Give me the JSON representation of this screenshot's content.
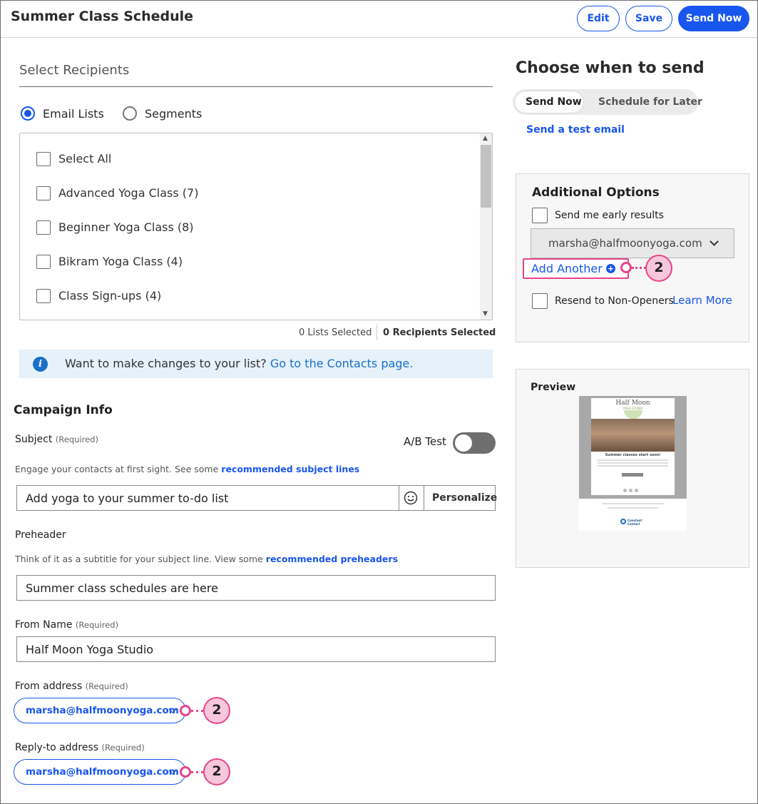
{
  "header": {
    "title": "Summer Class Schedule",
    "edit_label": "Edit",
    "save_label": "Save",
    "send_now_label": "Send Now"
  },
  "recipients": {
    "section_title": "Select Recipients",
    "radio_email_lists": "Email Lists",
    "radio_segments": "Segments",
    "selected_radio": "Email Lists",
    "items": [
      {
        "label": "Select All",
        "checked": false
      },
      {
        "label": "Advanced Yoga Class (7)",
        "checked": false
      },
      {
        "label": "Beginner Yoga Class (8)",
        "checked": false
      },
      {
        "label": "Bikram Yoga Class (4)",
        "checked": false
      },
      {
        "label": "Class Sign-ups (4)",
        "checked": false
      }
    ],
    "lists_selected": "0 Lists Selected",
    "recipients_selected": "0 Recipients Selected",
    "info_text": "Want to make changes to your list?",
    "info_link": "Go to the Contacts page."
  },
  "campaign": {
    "title": "Campaign Info",
    "subject_label": "Subject",
    "required": "(Required)",
    "ab_test_label": "A/B Test",
    "ab_test_on": false,
    "subject_help": "Engage your contacts at first sight. See some",
    "subject_help_link": "recommended subject lines",
    "subject_value": "Add yoga to your summer to-do list",
    "emoji_icon": "smiley-icon",
    "personalize_label": "Personalize",
    "preheader_label": "Preheader",
    "preheader_help": "Think of it as a subtitle for your subject line. View some",
    "preheader_help_link": "recommended preheaders",
    "preheader_value": "Summer class schedules are here",
    "from_name_label": "From Name",
    "from_name_value": "Half Moon Yoga Studio",
    "from_address_label": "From address",
    "from_address_value": "marsha@halfmoonyoga.com",
    "reply_to_label": "Reply-to address",
    "reply_to_value": "marsha@halfmoonyoga.com"
  },
  "callouts": {
    "number": "2"
  },
  "send": {
    "title": "Choose when to send",
    "tab_send_now": "Send Now",
    "tab_schedule_later": "Schedule for Later",
    "active_tab": "Send Now",
    "test_email_link": "Send a test email"
  },
  "options": {
    "title": "Additional Options",
    "early_results_label": "Send me early results",
    "early_results_email": "marsha@halfmoonyoga.com",
    "add_another_label": "Add Another",
    "resend_label": "Resend to Non-Openers",
    "learn_more_label": "Learn More"
  },
  "preview": {
    "title": "Preview",
    "thumb_brand_line1": "Half Moon",
    "thumb_brand_line2": "YOGA STUDIO",
    "thumb_headline": "Summer classes start soon!",
    "thumb_footer_brand": "Constant Contact"
  },
  "colors": {
    "accent": "#1856ed",
    "callout": "#e4468a",
    "callout_fill": "#f8c7dd",
    "info_bg": "#e6f1fa"
  }
}
